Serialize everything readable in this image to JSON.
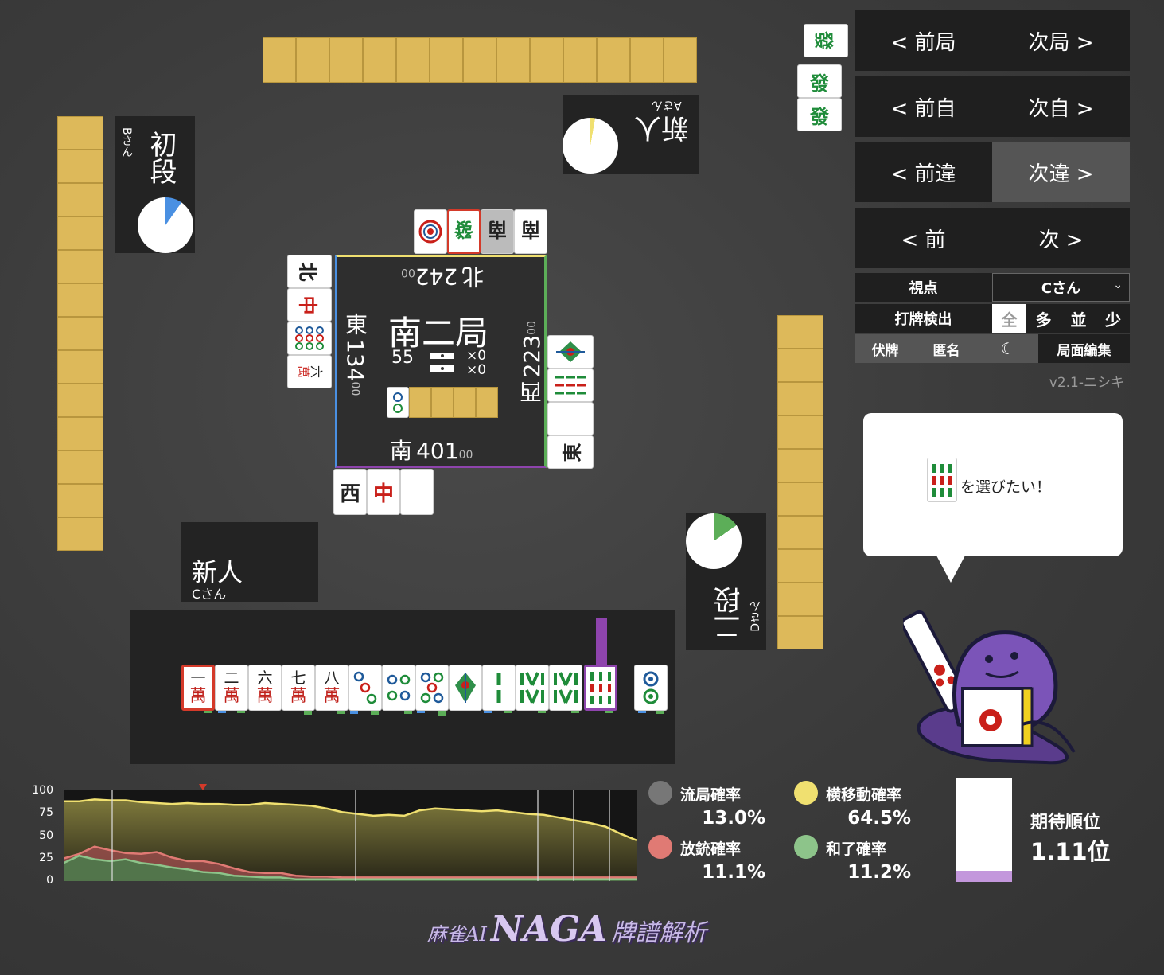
{
  "nav": {
    "prev_round": "< 前局",
    "next_round": "次局 >",
    "prev_self": "< 前自",
    "next_self": "次自 >",
    "prev_diff": "< 前違",
    "next_diff": "次違 >",
    "prev": "< 前",
    "next": "次 >"
  },
  "settings": {
    "viewpoint_label": "視点",
    "viewpoint_value": "Cさん",
    "detect_label": "打牌検出",
    "detect_options": [
      "全",
      "多",
      "並",
      "少"
    ],
    "hide_tiles": "伏牌",
    "anonymous": "匿名",
    "edit_position": "局面編集",
    "version": "v2.1-ニシキ"
  },
  "speech": {
    "text": "を選びたい！"
  },
  "players": {
    "top": {
      "rank": "新人",
      "name": "Aさん"
    },
    "left": {
      "rank": "初段",
      "name": "Bさん"
    },
    "bottom": {
      "rank": "新人",
      "name": "Cさん"
    },
    "right": {
      "rank": "二段",
      "name": "Dさん"
    }
  },
  "center": {
    "round": "南二局",
    "honba": "55",
    "counter1": "×0",
    "counter2": "×0",
    "scores": {
      "north": {
        "wind": "北",
        "score": "242",
        "suffix": "00"
      },
      "east": {
        "wind": "東",
        "score": "134",
        "suffix": "00"
      },
      "west": {
        "wind": "西",
        "score": "223",
        "suffix": "00"
      },
      "south": {
        "wind": "南",
        "score": "401",
        "suffix": "00"
      }
    }
  },
  "discards": {
    "top": [
      "●",
      "發",
      "南",
      "南"
    ],
    "left": [
      "北",
      "中",
      "⑨",
      "六萬"
    ],
    "right": [
      "1索",
      "9索",
      "白",
      "東"
    ],
    "bottom": [
      "西",
      "中",
      "白"
    ]
  },
  "hand": {
    "tiles": [
      {
        "n": "一",
        "s": "萬"
      },
      {
        "n": "二",
        "s": "萬"
      },
      {
        "n": "六",
        "s": "萬"
      },
      {
        "n": "七",
        "s": "萬"
      },
      {
        "n": "八",
        "s": "萬"
      }
    ]
  },
  "stats": {
    "draw_label": "流局確率",
    "draw_value": "13.0%",
    "move_label": "横移動確率",
    "move_value": "64.5%",
    "deal_label": "放銃確率",
    "deal_value": "11.1%",
    "win_label": "和了確率",
    "win_value": "11.2%",
    "rank_label": "期待順位",
    "rank_value": "1.11位",
    "rank_fill": 0.11
  },
  "chart_data": {
    "type": "area",
    "yticks": [
      "100",
      "75",
      "50",
      "25",
      "0"
    ],
    "ylim": [
      0,
      100
    ],
    "series": [
      {
        "color": "#f0e070",
        "values": [
          88,
          88,
          90,
          89,
          89,
          87,
          86,
          85,
          86,
          85,
          85,
          84,
          84,
          86,
          85,
          84,
          83,
          80,
          76,
          74,
          72,
          73,
          72,
          78,
          80,
          79,
          78,
          77,
          78,
          76,
          74,
          73,
          70,
          67,
          64,
          60,
          52,
          45
        ]
      },
      {
        "color": "#e07a74",
        "values": [
          25,
          30,
          38,
          34,
          31,
          30,
          32,
          26,
          22,
          22,
          19,
          14,
          10,
          9,
          9,
          6,
          5,
          5,
          4,
          4,
          4,
          4,
          4,
          4,
          4,
          4,
          4,
          4,
          4,
          4,
          4,
          4,
          4,
          4,
          4,
          4,
          4,
          4
        ]
      },
      {
        "color": "#8dc48a",
        "values": [
          20,
          28,
          24,
          22,
          24,
          20,
          18,
          15,
          13,
          10,
          9,
          6,
          5,
          4,
          4,
          2,
          2,
          2,
          2,
          2,
          2,
          2,
          2,
          2,
          2,
          2,
          2,
          2,
          2,
          2,
          2,
          2,
          2,
          2,
          2,
          2,
          2,
          2
        ]
      }
    ]
  },
  "footer": {
    "logo_pre": "麻雀AI",
    "logo_main": "NAGA",
    "logo_post": "牌譜解析"
  }
}
